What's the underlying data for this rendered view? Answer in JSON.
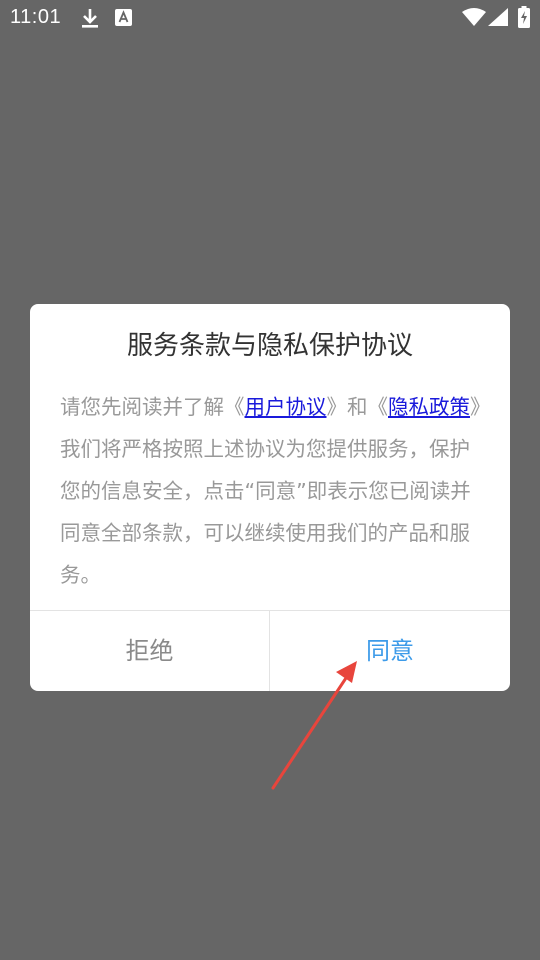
{
  "status_bar": {
    "time": "11:01",
    "icons": [
      "download-icon",
      "a-notification-icon",
      "wifi-icon",
      "signal-icon",
      "battery-charging-icon"
    ]
  },
  "dialog": {
    "title": "服务条款与隐私保护协议",
    "body_prefix": "请您先阅读并了解《",
    "user_agreement_link": "用户协议",
    "body_middle": "》和《",
    "privacy_policy_link": "隐私政策",
    "body_suffix": "》我们将严格按照上述协议为您提供服务，保护您的信息安全，点击“同意”即表示您已阅读并同意全部条款，可以继续使用我们的产品和服务。",
    "reject_label": "拒绝",
    "agree_label": "同意"
  },
  "colors": {
    "overlay": "#666666",
    "dialog_bg": "#ffffff",
    "link": "#1a1adb",
    "agree": "#3d9be9",
    "arrow": "#e8453c"
  }
}
